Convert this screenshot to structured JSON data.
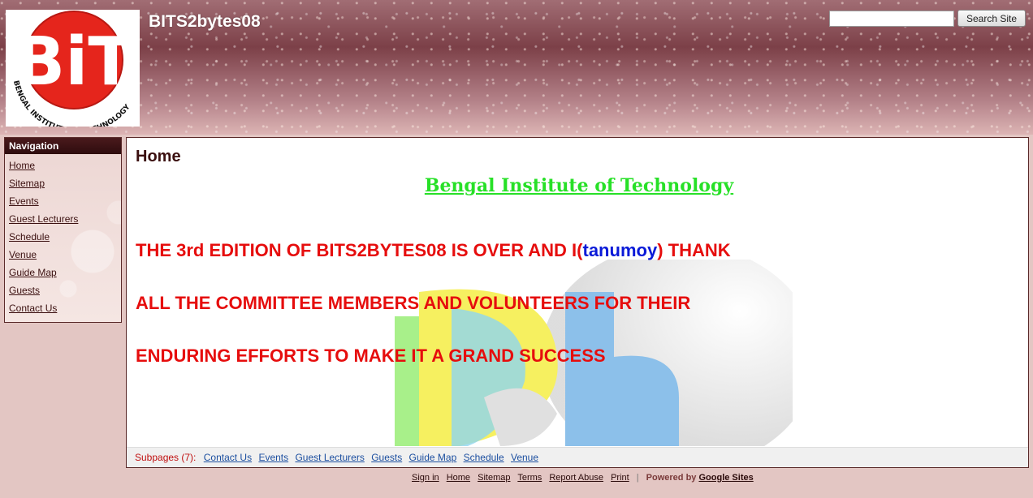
{
  "header": {
    "site_title": "BITS2bytes08",
    "search_placeholder": "",
    "search_button": "Search Site",
    "logo_text": "BiT",
    "logo_arc_text": "BENGAL INSTITUTE OF TECHNOLOGY"
  },
  "nav": {
    "heading": "Navigation",
    "items": [
      "Home",
      "Sitemap",
      "Events",
      "Guest Lecturers",
      "Schedule",
      "Venue",
      "Guide Map",
      "Guests",
      "Contact Us"
    ]
  },
  "content": {
    "page_title": "Home",
    "institute": "Bengal Institute of Technology",
    "line1_before": "THE 3rd EDITION OF BITS2BYTES08 IS OVER AND I(",
    "line1_name": "tanumoy",
    "line1_after": ") THANK",
    "line2": "ALL THE COMMITTEE MEMBERS AND VOLUNTEERS FOR THEIR",
    "line3": "ENDURING EFFORTS TO MAKE IT A GRAND SUCCESS"
  },
  "subpages": {
    "label": "Subpages (7):",
    "items": [
      "Contact Us",
      "Events",
      "Guest Lecturers",
      "Guests",
      "Guide Map",
      "Schedule",
      "Venue"
    ]
  },
  "footer": {
    "links": [
      "Sign in",
      "Home",
      "Sitemap",
      "Terms",
      "Report Abuse",
      "Print"
    ],
    "separator": "|",
    "powered_by": "Powered by",
    "google_sites": "Google Sites"
  },
  "colors": {
    "header_dark": "#7c4048",
    "nav_head": "#2e0c0e",
    "institute_green": "#27e027",
    "headline_red": "#e60d0d",
    "name_blue": "#0a1ad8",
    "link_blue": "#1c4fa0"
  }
}
